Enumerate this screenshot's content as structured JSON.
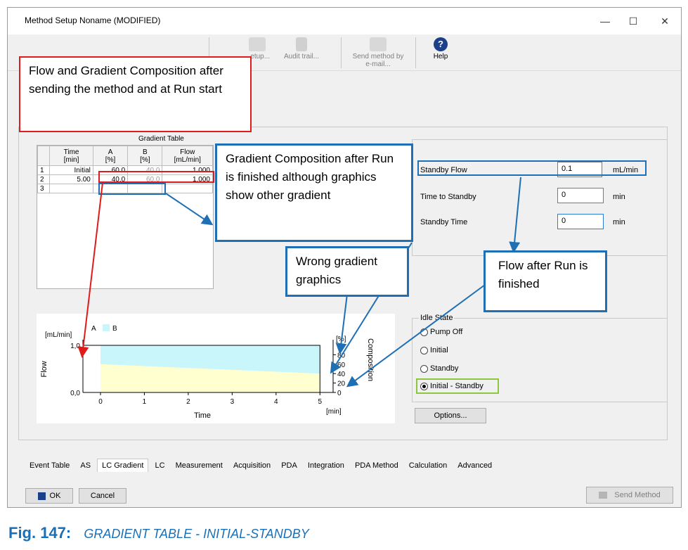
{
  "window": {
    "title": "Method Setup Noname (MODIFIED)",
    "minimize": "—",
    "maximize": "☐",
    "close": "✕"
  },
  "toolbar": {
    "items": [
      {
        "label": "...etup...",
        "icon": "setup-icon"
      },
      {
        "label": "Audit trail...",
        "icon": "audit-trail-icon"
      },
      {
        "label": "Send method by e-mail...",
        "icon": "send-email-icon"
      },
      {
        "label": "Help",
        "icon": "help-icon"
      }
    ]
  },
  "gradient_table": {
    "title": "Gradient Table",
    "headers": [
      "",
      "Time\n[min]",
      "A\n[%]",
      "B\n[%]",
      "Flow\n[mL/min]"
    ],
    "rows": [
      {
        "n": "1",
        "time": "Initial",
        "a": "60.0",
        "b": "40.0",
        "flow": "1.000"
      },
      {
        "n": "2",
        "time": "5.00",
        "a": "40.0",
        "b": "60.0",
        "flow": "1.000"
      },
      {
        "n": "3",
        "time": "",
        "a": "",
        "b": "",
        "flow": ""
      }
    ]
  },
  "standby": {
    "flow_label": "Standby Flow",
    "flow_value": "0.1",
    "flow_unit": "mL/min",
    "time_to_label": "Time to Standby",
    "time_to_value": "0",
    "time_to_unit": "min",
    "time_label": "Standby Time",
    "time_value": "0",
    "time_unit": "min"
  },
  "idle_state": {
    "title": "Idle State",
    "options": [
      "Pump Off",
      "Initial",
      "Standby",
      "Initial - Standby"
    ],
    "selected": "Initial - Standby"
  },
  "options_button": "Options...",
  "chart_data": {
    "type": "area",
    "legend": [
      "A",
      "B"
    ],
    "xlabel": "Time",
    "x_unit": "[min]",
    "ylabel_left": "Flow",
    "left_unit": "[mL/min]",
    "ylabel_right": "Composition",
    "right_unit": "[%]",
    "x_ticks": [
      "0",
      "1",
      "2",
      "3",
      "4",
      "5"
    ],
    "left_ticks": [
      "1,0",
      "0,0"
    ],
    "right_ticks": [
      "80",
      "60",
      "40",
      "20",
      "0"
    ],
    "xlim": [
      -0.4,
      5.3
    ],
    "series": [
      {
        "name": "A",
        "x": [
          0,
          5
        ],
        "values": [
          60,
          40
        ]
      },
      {
        "name": "B",
        "x": [
          0,
          5
        ],
        "values": [
          40,
          60
        ]
      }
    ],
    "flow": {
      "x": [
        0,
        5,
        5
      ],
      "values": [
        1.0,
        1.0,
        0.0
      ]
    },
    "colors": {
      "A": "#ffffd0",
      "B": "#c8f6fb"
    }
  },
  "tabs": [
    "Event Table",
    "AS",
    "LC Gradient",
    "LC",
    "Measurement",
    "Acquisition",
    "PDA",
    "Integration",
    "PDA Method",
    "Calculation",
    "Advanced"
  ],
  "active_tab": "LC Gradient",
  "buttons": {
    "ok": "OK",
    "cancel": "Cancel",
    "send": "Send Method"
  },
  "annotations": {
    "red": "Flow and Gradient Composition after sending the method and at Run start",
    "blue1": "Gradient Composition after Run is finished although graphics show other gradient",
    "blue2": "Wrong gradient graphics",
    "blue3": "Flow after Run is finished"
  },
  "colors": {
    "annotation_red": "#e01b1b",
    "annotation_blue": "#1f6fb5",
    "highlight_green": "#8dc63f",
    "caption_blue": "#1a6fb5"
  },
  "caption": {
    "fig": "Fig. 147:",
    "text": "GRADIENT TABLE - INITIAL-STANDBY"
  }
}
